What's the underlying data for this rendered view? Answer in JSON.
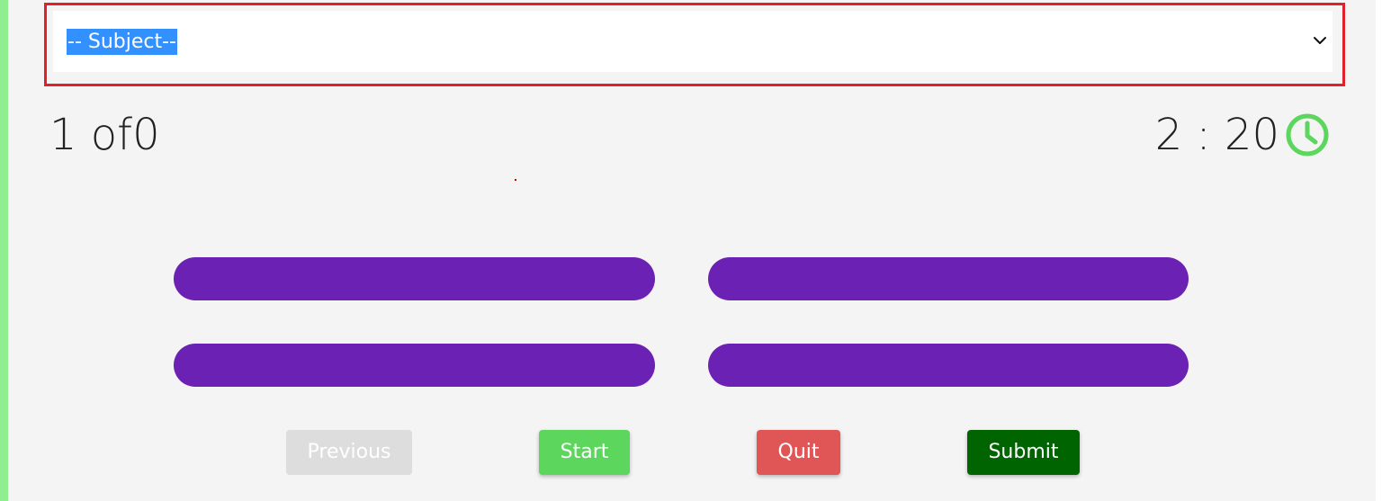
{
  "subject_select": {
    "selected": "-- Subject--"
  },
  "progress": {
    "current": "1",
    "separator": "of",
    "total": "0",
    "text": "1 of0"
  },
  "timer": {
    "text": "2 : 20",
    "icon": "clock-icon",
    "icon_color": "#5cd65c"
  },
  "question": {
    "text": "."
  },
  "options": [
    {
      "label": ""
    },
    {
      "label": ""
    },
    {
      "label": ""
    },
    {
      "label": ""
    }
  ],
  "buttons": {
    "previous": "Previous",
    "start": "Start",
    "quit": "Quit",
    "submit": "Submit"
  },
  "colors": {
    "option_purple": "#6b21b3",
    "start_green": "#5cd65c",
    "quit_red": "#e05555",
    "submit_darkgreen": "#006400",
    "previous_disabled": "#dddddd",
    "highlight_border": "#e0202a",
    "side_stripe": "#90ee90"
  }
}
